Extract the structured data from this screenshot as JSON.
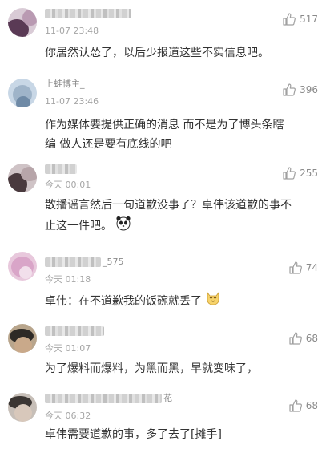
{
  "comments": [
    {
      "username": "...友",
      "time": "11-07 23:48",
      "text": "你居然认怂了，以后少报道这些不实信息吧。",
      "likes": "517"
    },
    {
      "username": "上蛙博主_",
      "time": "11-07 23:46",
      "text": "作为媒体要提供正确的消息 而不是为了博头条瞎编 做人还是要有底线的吧",
      "likes": "396"
    },
    {
      "username": "...",
      "time": "今天 00:01",
      "text": "散播谣言然后一句道歉没事了？卓伟该道歉的事不止这一件吧。",
      "likes": "255",
      "emoji": "panda"
    },
    {
      "username": "_575",
      "time": "今天 01:18",
      "text": "卓伟：在不道歉我的饭碗就丢了",
      "likes": "74",
      "emoji": "cat"
    },
    {
      "username": "...",
      "time": "今天 01:07",
      "text": "为了爆料而爆料，为黑而黑，早就变味了，",
      "likes": "68"
    },
    {
      "username": "...花",
      "time": "今天 06:32",
      "text": "卓伟需要道歉的事，多了去了",
      "tag": "[摊手]",
      "likes": "68"
    }
  ],
  "icons": {
    "like": "thumbs-up-icon"
  },
  "colors": {
    "text": "#333333",
    "meta": "#a6a6a6",
    "count": "#8a8a8a"
  }
}
